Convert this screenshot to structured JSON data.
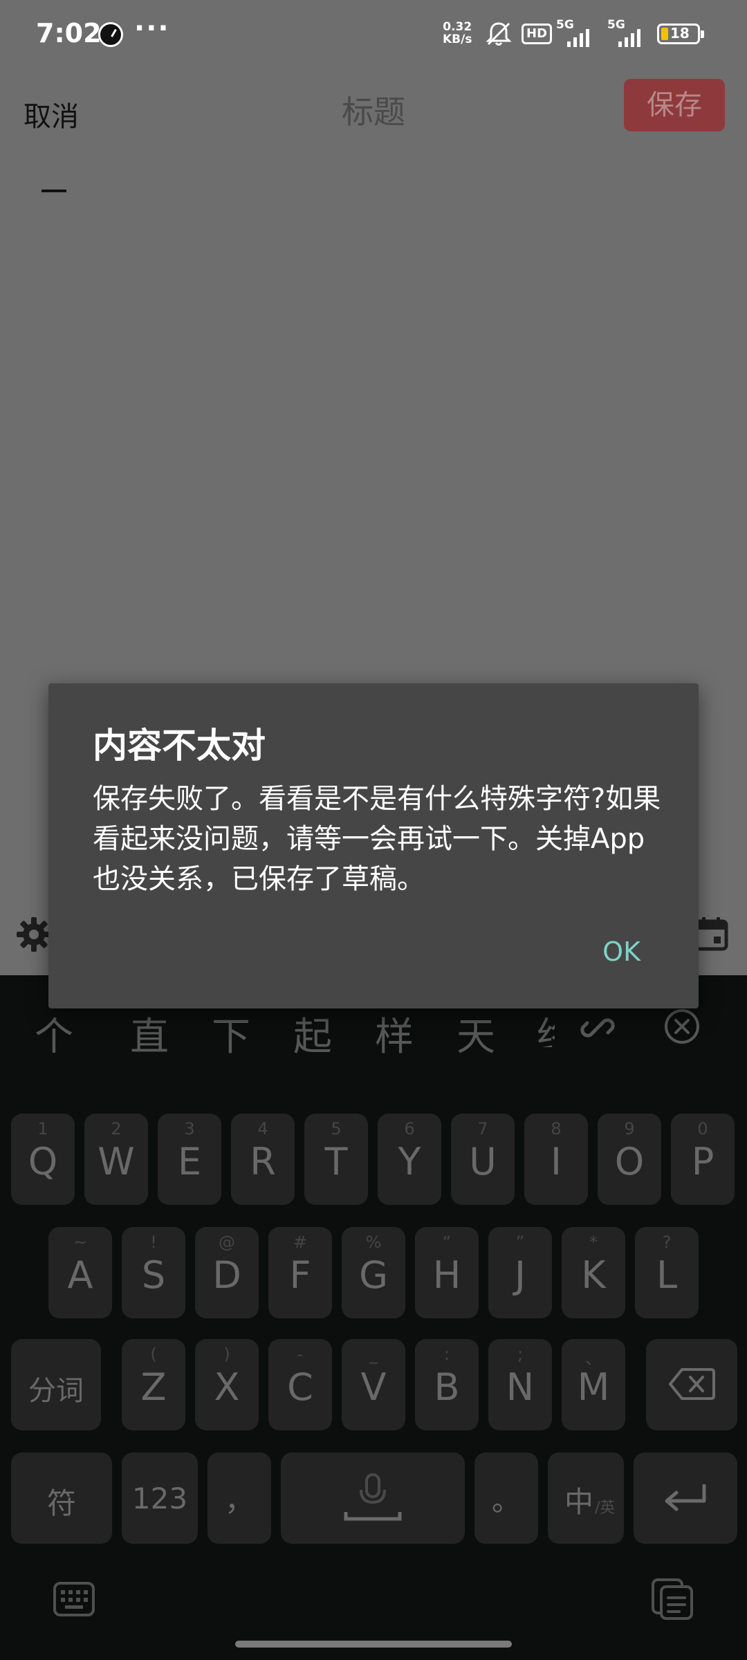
{
  "status_bar": {
    "time": "7:02",
    "more": "···",
    "speed_value": "0.32",
    "speed_unit": "KB/s",
    "hd_label": "HD",
    "net1": "5G",
    "net2": "5G",
    "battery_level": "18",
    "battery_fill_color": "#f2c200"
  },
  "editor": {
    "cancel_label": "取消",
    "title": "标题",
    "save_label": "保存",
    "save_color": "#8e3a3d"
  },
  "dialog": {
    "title": "内容不太对",
    "message": "保存失败了。看看是不是有什么特殊字符?如果看起来没问题，请等一会再试一下。关掉App也没关系，已保存了草稿。",
    "ok_label": "OK",
    "ok_color": "#7fd2c8"
  },
  "keyboard": {
    "candidates": [
      "个",
      "直",
      "下",
      "起",
      "样",
      "天"
    ],
    "candidate_partial": "终",
    "row1": [
      {
        "hint": "1",
        "key": "Q"
      },
      {
        "hint": "2",
        "key": "W"
      },
      {
        "hint": "3",
        "key": "E"
      },
      {
        "hint": "4",
        "key": "R"
      },
      {
        "hint": "5",
        "key": "T"
      },
      {
        "hint": "6",
        "key": "Y"
      },
      {
        "hint": "7",
        "key": "U"
      },
      {
        "hint": "8",
        "key": "I"
      },
      {
        "hint": "9",
        "key": "O"
      },
      {
        "hint": "0",
        "key": "P"
      }
    ],
    "row2": [
      {
        "hint": "~",
        "key": "A"
      },
      {
        "hint": "!",
        "key": "S"
      },
      {
        "hint": "@",
        "key": "D"
      },
      {
        "hint": "#",
        "key": "F"
      },
      {
        "hint": "%",
        "key": "G"
      },
      {
        "hint": "“",
        "key": "H"
      },
      {
        "hint": "”",
        "key": "J"
      },
      {
        "hint": "*",
        "key": "K"
      },
      {
        "hint": "?",
        "key": "L"
      }
    ],
    "row3": [
      {
        "hint": "(",
        "key": "Z"
      },
      {
        "hint": ")",
        "key": "X"
      },
      {
        "hint": "-",
        "key": "C"
      },
      {
        "hint": "_",
        "key": "V"
      },
      {
        "hint": ":",
        "key": "B"
      },
      {
        "hint": ";",
        "key": "N"
      },
      {
        "hint": "、",
        "key": "M"
      }
    ],
    "segment_label": "分词",
    "symbol_label": "符",
    "numeric_label": "123",
    "comma_label": "，",
    "period_label": "。",
    "lang_main": "中",
    "lang_sub": "/英"
  }
}
